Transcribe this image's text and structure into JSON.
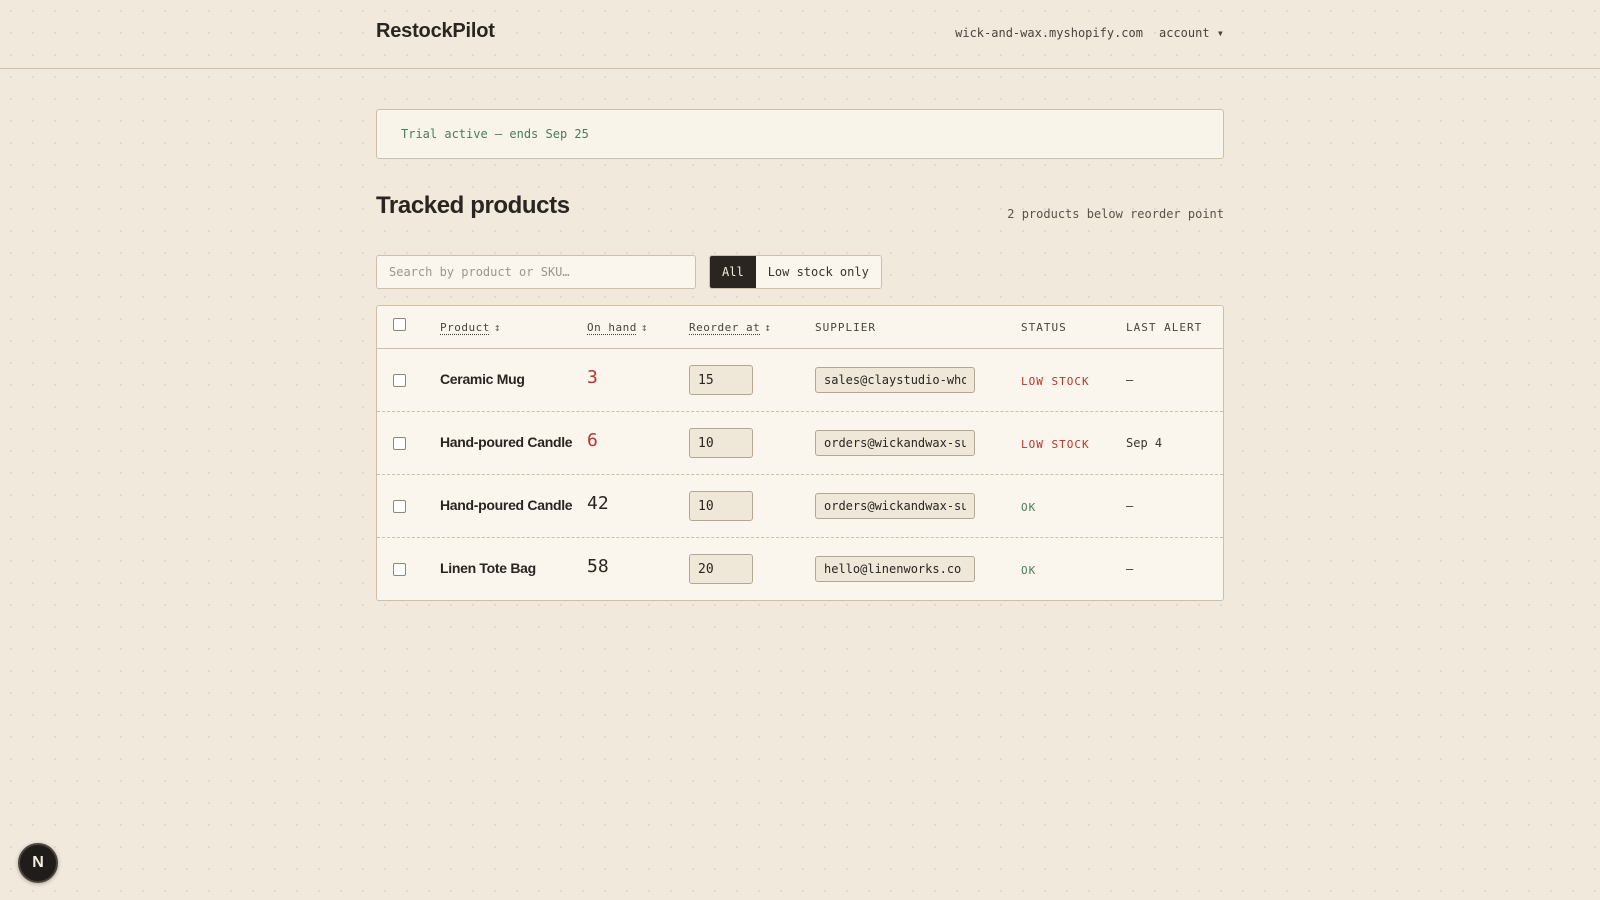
{
  "header": {
    "brand": "RestockPilot",
    "store": "wick-and-wax.myshopify.com",
    "account_label": "account ▾"
  },
  "banner": {
    "text": "Trial active — ends Sep 25"
  },
  "section": {
    "title": "Tracked products",
    "below_count": "2 products below reorder point"
  },
  "search": {
    "placeholder": "Search by product or SKU…",
    "value": ""
  },
  "filters": {
    "all": "All",
    "low": "Low stock only",
    "active": "all"
  },
  "table": {
    "columns": {
      "product": "Product",
      "on_hand": "On hand",
      "reorder_at": "Reorder at",
      "supplier": "SUPPLIER",
      "status": "STATUS",
      "last_alert": "LAST ALERT"
    },
    "sort_icon": "↕",
    "rows": [
      {
        "product": "Ceramic Mug",
        "on_hand": "3",
        "reorder_at": "15",
        "supplier": "sales@claystudio-wholesale.com",
        "status": "LOW STOCK",
        "last_alert": "—"
      },
      {
        "product": "Hand-poured Candle",
        "on_hand": "6",
        "reorder_at": "10",
        "supplier": "orders@wickandwax-supply.com",
        "status": "LOW STOCK",
        "last_alert": "Sep 4"
      },
      {
        "product": "Hand-poured Candle",
        "on_hand": "42",
        "reorder_at": "10",
        "supplier": "orders@wickandwax-supply.com",
        "status": "OK",
        "last_alert": "—"
      },
      {
        "product": "Linen Tote Bag",
        "on_hand": "58",
        "reorder_at": "20",
        "supplier": "hello@linenworks.co",
        "status": "OK",
        "last_alert": "—"
      }
    ]
  },
  "fab": {
    "label": "N"
  },
  "colors": {
    "low": "#b8352a",
    "ok": "#4f7a5b",
    "accent": "#2a2521"
  }
}
